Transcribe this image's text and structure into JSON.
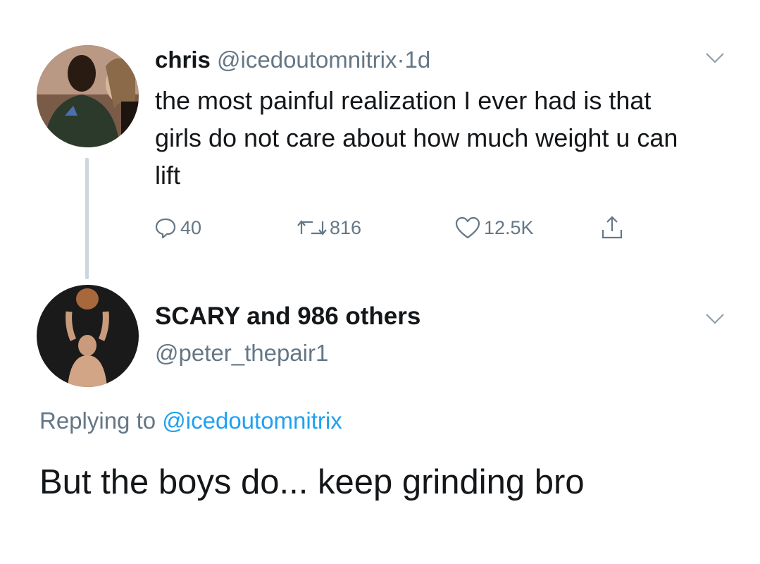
{
  "tweet": {
    "author_name": "chris",
    "author_handle": "@icedoutomnitrix",
    "separator": "·",
    "time": "1d",
    "text": "the most painful realization I ever had is that girls do not care about how much weight u can lift",
    "actions": {
      "replies": "40",
      "retweets": "816",
      "likes": "12.5K"
    }
  },
  "reply": {
    "display_name": "SCARY and 986 others",
    "handle": "@peter_thepair1",
    "replying_prefix": "Replying to",
    "replying_to": "@icedoutomnitrix",
    "text": "But the boys do... keep grinding bro"
  },
  "icons": {
    "reply": "comment-bubble-icon",
    "retweet": "retweet-arrows-icon",
    "like": "heart-icon",
    "share": "share-upload-icon",
    "menu": "chevron-down-icon"
  },
  "colors": {
    "text": "#14171a",
    "muted": "#657786",
    "link": "#1da1f2",
    "thread_line": "#ccd6dd"
  }
}
